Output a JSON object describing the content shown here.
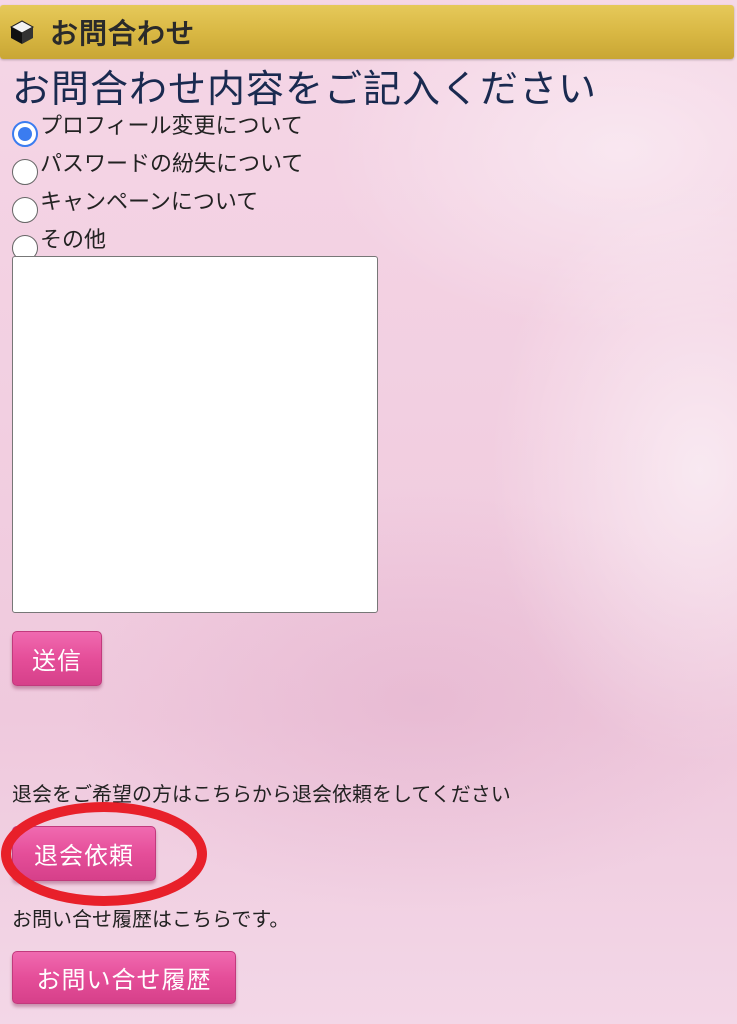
{
  "header": {
    "title": "お問合わせ",
    "icon": "cube-icon"
  },
  "form": {
    "heading": "お問合わせ内容をご記入ください",
    "options": [
      {
        "label": "プロフィール変更について",
        "checked": true
      },
      {
        "label": "パスワードの紛失について",
        "checked": false
      },
      {
        "label": "キャンペーンについて",
        "checked": false
      },
      {
        "label": "その他",
        "checked": false
      }
    ],
    "message_value": "",
    "submit_label": "送信"
  },
  "withdraw": {
    "text": "退会をご希望の方はこちらから退会依頼をしてください",
    "button_label": "退会依頼"
  },
  "history": {
    "text": "お問い合せ履歴はこちらです。",
    "button_label": "お問い合せ履歴"
  },
  "colors": {
    "header_gold": "#d9b844",
    "button_pink": "#e54e99",
    "heading_navy": "#1a2a50",
    "radio_blue": "#3b7cf0",
    "annotation_red": "#e8202a"
  }
}
